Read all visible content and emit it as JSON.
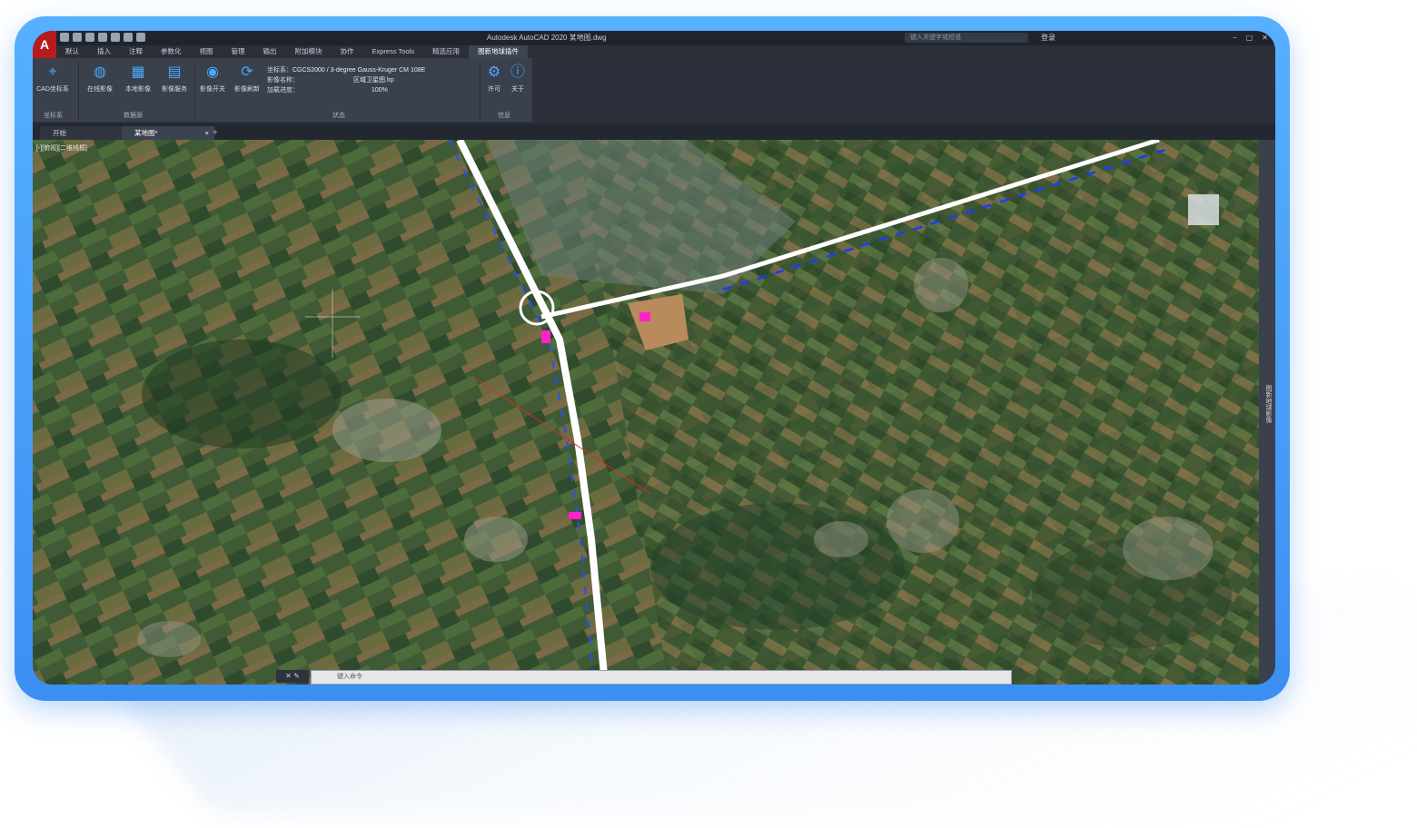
{
  "app": {
    "logo": "A",
    "title": "Autodesk AutoCAD 2020  某地图.dwg",
    "search_placeholder": "键入关键字或短语",
    "login": "登录",
    "window_controls": [
      "−",
      "▢",
      "✕"
    ]
  },
  "menu_tabs": [
    "默认",
    "插入",
    "注释",
    "参数化",
    "视图",
    "管理",
    "输出",
    "附加模块",
    "协作",
    "Express Tools",
    "精选应用",
    "图新地球插件"
  ],
  "ribbon": {
    "buttons": [
      {
        "label": "CAD坐标系",
        "icon": "pin-icon"
      },
      {
        "label": "在线影像",
        "icon": "globe-icon"
      },
      {
        "label": "本地影像",
        "icon": "layers-icon"
      },
      {
        "label": "影像服务",
        "icon": "grid-icon"
      },
      {
        "label": "影像开关",
        "icon": "eye-icon"
      },
      {
        "label": "影像刷新",
        "icon": "refresh-icon"
      }
    ],
    "status": {
      "coord_label": "坐标系：",
      "coord_value": "CGCS2000 / 3-degree Gauss-Kruger CM 108E",
      "image_label": "影像名称：",
      "image_value": "区域卫星图.lrp",
      "progress_label": "加载进度：",
      "progress_value": "100%"
    },
    "info_buttons": [
      {
        "label": "许可",
        "icon": "gear-icon"
      },
      {
        "label": "关于",
        "icon": "info-icon"
      }
    ],
    "panels": [
      "坐标系",
      "数据源",
      "状态",
      "信息"
    ]
  },
  "doc_tabs": [
    {
      "label": "开始"
    },
    {
      "label": "某地图*"
    }
  ],
  "viewport": {
    "label": "[-][俯视][二维线框]",
    "side_panel": "图新地球影像"
  },
  "command": {
    "placeholder": "键入命令"
  }
}
